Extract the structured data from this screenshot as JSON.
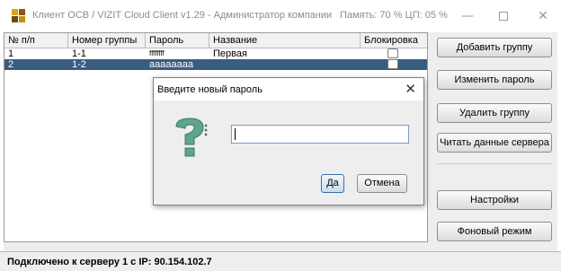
{
  "window": {
    "title": "Клиент ОСВ / VIZIT Cloud Client v1.29 - Администратор компании",
    "sysinfo": "Память: 70 %  ЦП: 05 %"
  },
  "table": {
    "headers": [
      "№ п/п",
      "Номер группы",
      "Пароль",
      "Название",
      "Блокировка"
    ],
    "rows": [
      {
        "num": "1",
        "group": "1-1",
        "password": "ffffffff",
        "name": "Первая",
        "blocked": false
      },
      {
        "num": "2",
        "group": "1-2",
        "password": "aaaaaaaa",
        "name": "",
        "blocked": false
      }
    ]
  },
  "sidebar": {
    "add_group": "Добавить группу",
    "change_password": "Изменить пароль",
    "delete_group": "Удалить группу",
    "read_server": "Читать данные сервера",
    "settings": "Настройки",
    "background": "Фоновый режим"
  },
  "status": {
    "text": "Подключено к серверу 1 с IP:  90.154.102.7"
  },
  "dialog": {
    "title": "Введите новый пароль",
    "input_value": "",
    "ok_label": "Да",
    "cancel_label": "Отмена",
    "icon": "question-icon"
  },
  "colors": {
    "selection": "#395d80",
    "icon_green": "#5ea58a"
  }
}
